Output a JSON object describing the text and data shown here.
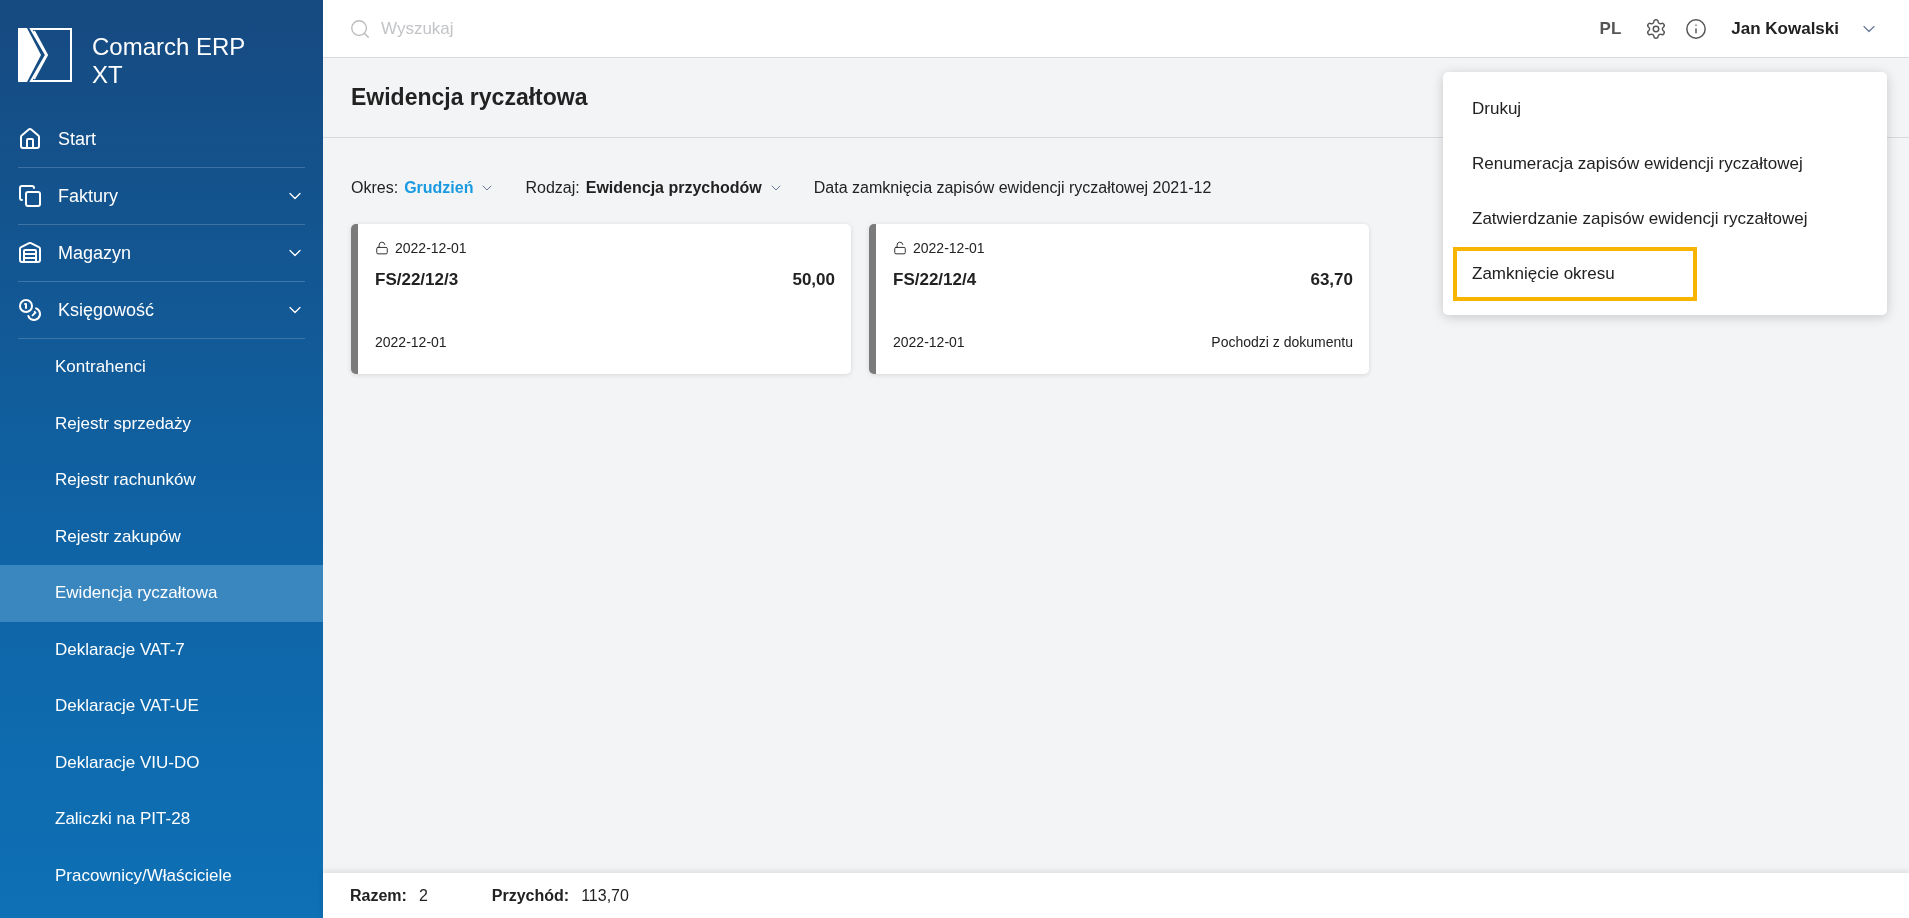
{
  "app": {
    "name": "Comarch ERP XT"
  },
  "sidebar": {
    "items": [
      {
        "label": "Start",
        "kind": "link"
      },
      {
        "label": "Faktury",
        "kind": "group"
      },
      {
        "label": "Magazyn",
        "kind": "group"
      },
      {
        "label": "Księgowość",
        "kind": "group",
        "children": [
          {
            "label": "Kontrahenci",
            "selected": false
          },
          {
            "label": "Rejestr sprzedaży",
            "selected": false
          },
          {
            "label": "Rejestr rachunków",
            "selected": false
          },
          {
            "label": "Rejestr zakupów",
            "selected": false
          },
          {
            "label": "Ewidencja ryczałtowa",
            "selected": true
          },
          {
            "label": "Deklaracje VAT-7",
            "selected": false
          },
          {
            "label": "Deklaracje VAT-UE",
            "selected": false
          },
          {
            "label": "Deklaracje VIU-DO",
            "selected": false
          },
          {
            "label": "Zaliczki na PIT-28",
            "selected": false
          },
          {
            "label": "Pracownicy/Właściciele",
            "selected": false
          }
        ]
      }
    ]
  },
  "topbar": {
    "search": {
      "placeholder": "Wyszukaj"
    },
    "language": "PL",
    "user": "Jan Kowalski"
  },
  "page": {
    "title": "Ewidencja ryczałtowa"
  },
  "filters": [
    {
      "label": "Okres:",
      "value": "Grudzień",
      "kind": "link"
    },
    {
      "label": "Rodzaj:",
      "value": "Ewidencja przychodów",
      "kind": "bold"
    }
  ],
  "closing_note": "Data zamknięcia zapisów ewidencji ryczałtowej 2021-12",
  "cards": [
    {
      "lock_date": "2022-12-01",
      "number": "FS/22/12/3",
      "amount": "50,00",
      "date": "2022-12-01"
    },
    {
      "lock_date": "2022-12-01",
      "number": "FS/22/12/4",
      "amount": "63,70",
      "date": "2022-12-01",
      "note": "Pochodzi z dokumentu"
    }
  ],
  "menu": {
    "items": [
      {
        "label": "Drukuj",
        "highlighted": false
      },
      {
        "label": "Renumeracja zapisów ewidencji ryczałtowej",
        "highlighted": false
      },
      {
        "label": "Zatwierdzanie zapisów ewidencji ryczałtowej",
        "highlighted": false
      },
      {
        "label": "Zamknięcie okresu",
        "highlighted": true
      }
    ]
  },
  "footer": [
    {
      "label": "Razem:",
      "value": "2"
    },
    {
      "label": "Przychód:",
      "value": "113,70"
    }
  ]
}
